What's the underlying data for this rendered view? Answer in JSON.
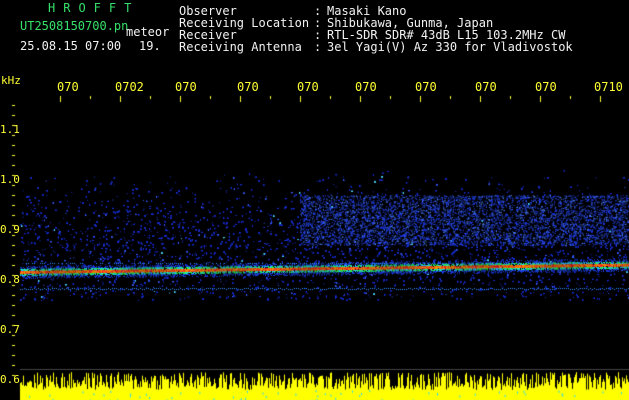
{
  "header": {
    "brand": "HROFFT",
    "filename": "UT2508150700.pn",
    "meteor": "meteor",
    "datetime": "25.08.15 07:00",
    "count": "19.",
    "info": [
      {
        "label": "Observer",
        "value": "Masaki Kano"
      },
      {
        "label": "Receiving Location",
        "value": "Shibukawa, Gunma, Japan"
      },
      {
        "label": "Receiver",
        "value": "RTL-SDR SDR# 43dB L15 103.2MHz CW"
      },
      {
        "label": "Receiving Antenna",
        "value": "3el Yagi(V) Az 330 for Vladivostok"
      }
    ]
  },
  "axis": {
    "unit": "kHz",
    "freq_labels": [
      "1.1",
      "1.0",
      "0.9",
      "0.8",
      "0.7",
      "0.6"
    ],
    "time_labels": [
      "070",
      "0702",
      "070",
      "070",
      "070",
      "070",
      "070",
      "070",
      "070",
      "0710"
    ]
  },
  "colors": {
    "header_green": "#35e06a",
    "axis_yellow": "#ffff33",
    "signal_red": "#ff2020",
    "noise_blue": "#1a2fd0"
  }
}
